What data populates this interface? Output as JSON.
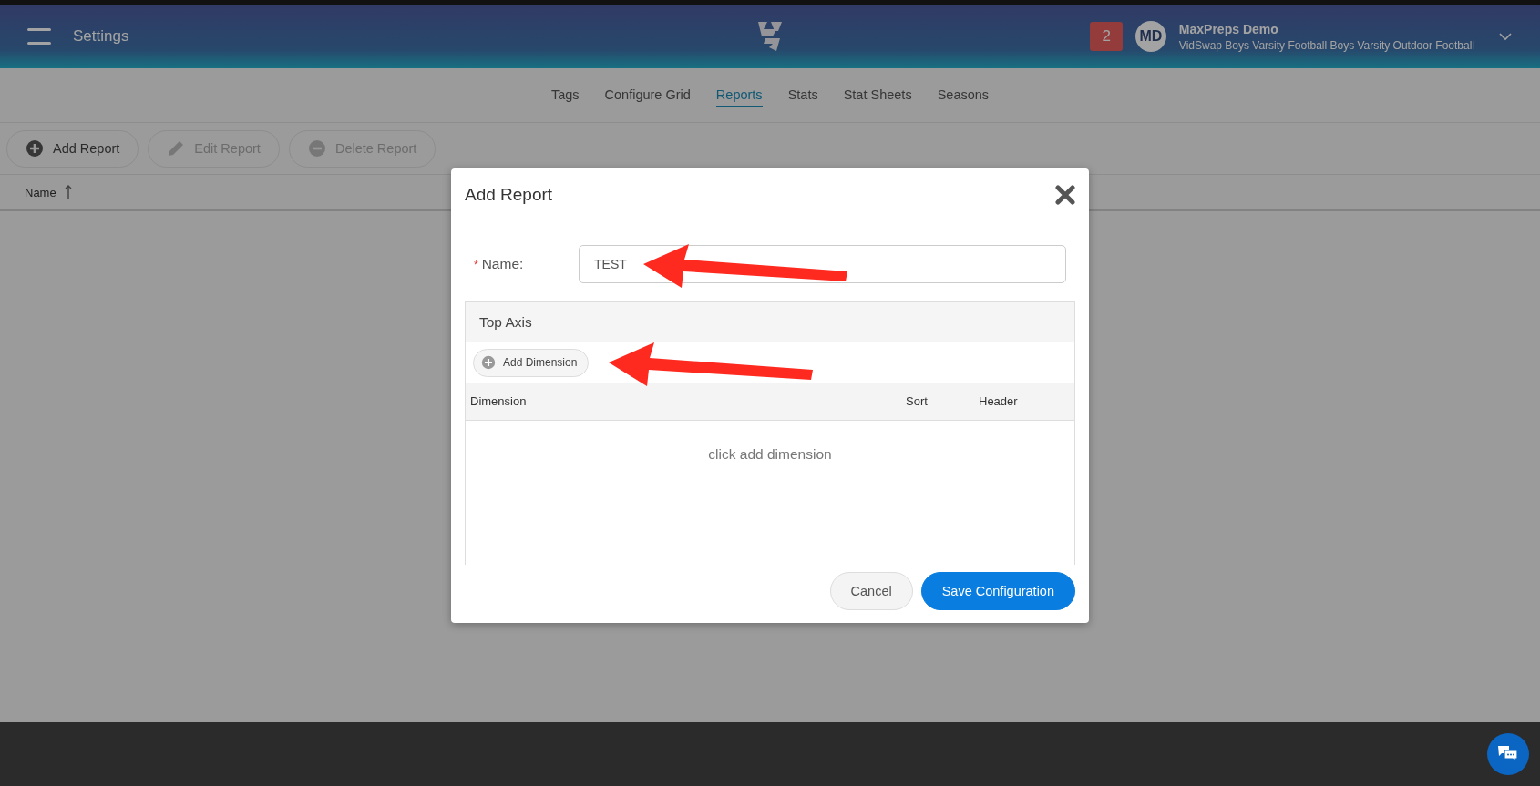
{
  "header": {
    "title": "Settings",
    "notification_count": "2",
    "avatar_initials": "MD",
    "user_name": "MaxPreps Demo",
    "user_subtitle": "VidSwap Boys Varsity Football Boys Varsity Outdoor Football"
  },
  "tabs": [
    {
      "label": "Tags",
      "selected": false
    },
    {
      "label": "Configure Grid",
      "selected": false
    },
    {
      "label": "Reports",
      "selected": true
    },
    {
      "label": "Stats",
      "selected": false
    },
    {
      "label": "Stat Sheets",
      "selected": false
    },
    {
      "label": "Seasons",
      "selected": false
    }
  ],
  "toolbar": [
    {
      "label": "Add Report",
      "kind": "add",
      "disabled": false
    },
    {
      "label": "Edit Report",
      "kind": "edit",
      "disabled": true
    },
    {
      "label": "Delete Report",
      "kind": "delete",
      "disabled": true
    }
  ],
  "table": {
    "columns": [
      {
        "label": "Name",
        "sorted_ascending": true
      }
    ]
  },
  "modal": {
    "title": "Add Report",
    "name_field": {
      "label": "Name:",
      "required_mark": "*",
      "value": "TEST"
    },
    "section": {
      "title": "Top Axis",
      "add_button": "Add Dimension",
      "columns": [
        "Dimension",
        "Sort",
        "Header"
      ],
      "empty_text": "click add dimension"
    },
    "buttons": [
      {
        "label": "Cancel",
        "kind": "secondary"
      },
      {
        "label": "Save Configuration",
        "kind": "primary"
      }
    ]
  }
}
